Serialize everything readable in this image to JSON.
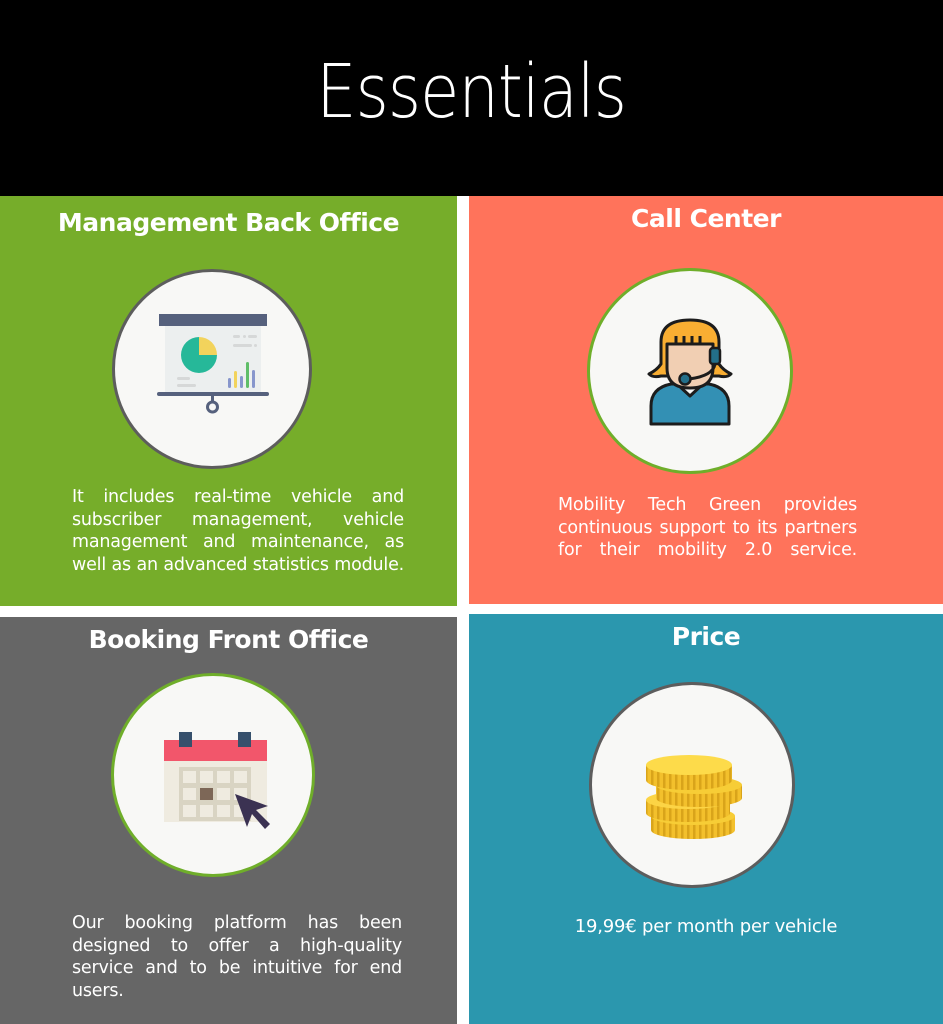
{
  "header": {
    "title": "Essentials",
    "background": "#000000"
  },
  "panels": [
    {
      "id": "management-back-office",
      "title": "Management Back Office",
      "icon": "presentation-chart-icon",
      "color": "#76ad2a",
      "description": "It includes real-time vehicle and subscriber management, vehicle management and maintenance, as well as an advanced statistics module."
    },
    {
      "id": "call-center",
      "title": "Call Center",
      "icon": "headset-operator-icon",
      "color": "#ff735b",
      "description": "Mobility Tech Green provides continuous support to its partners for their mobility 2.0 service."
    },
    {
      "id": "booking-front-office",
      "title": "Booking Front  Office",
      "icon": "calendar-cursor-icon",
      "color": "#666666",
      "description": "Our booking platform has been designed to offer a high-quality service and to be intuitive for end users."
    },
    {
      "id": "price",
      "title": "Price",
      "icon": "coin-stack-icon",
      "color": "#2b97ae",
      "description": "19,99€ per month per vehicle"
    }
  ]
}
